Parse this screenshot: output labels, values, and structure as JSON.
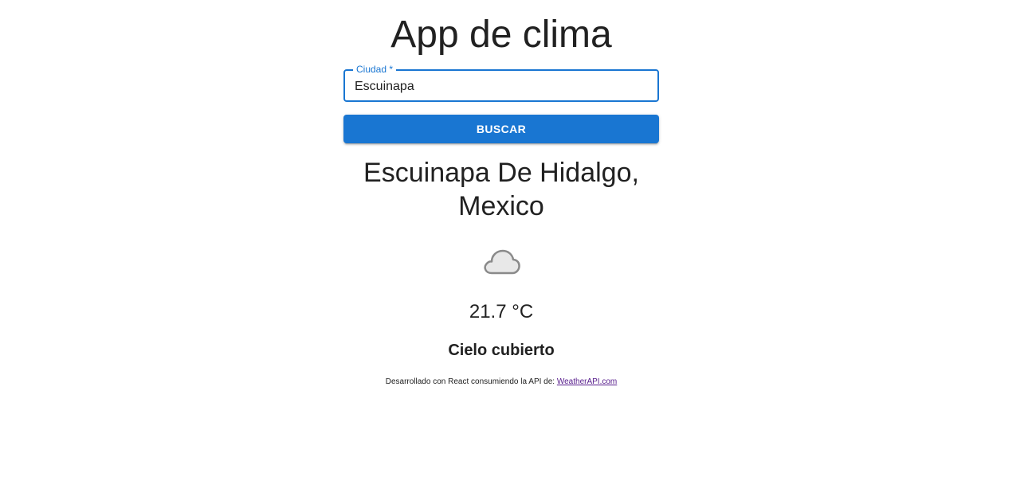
{
  "app": {
    "title": "App de clima"
  },
  "search": {
    "label": "Ciudad *",
    "value": "Escuinapa",
    "button_label": "BUSCAR"
  },
  "weather": {
    "city_line1": "Escuinapa De Hidalgo,",
    "city_line2": "Mexico",
    "icon": "cloud-icon",
    "temperature": "21.7 °C",
    "condition": "Cielo cubierto"
  },
  "footer": {
    "text": "Desarrollado con React consumiendo la API de: ",
    "link_text": "WeatherAPI.com"
  },
  "colors": {
    "primary": "#1976d2",
    "text": "#212121",
    "link_visited": "#551a8b"
  }
}
